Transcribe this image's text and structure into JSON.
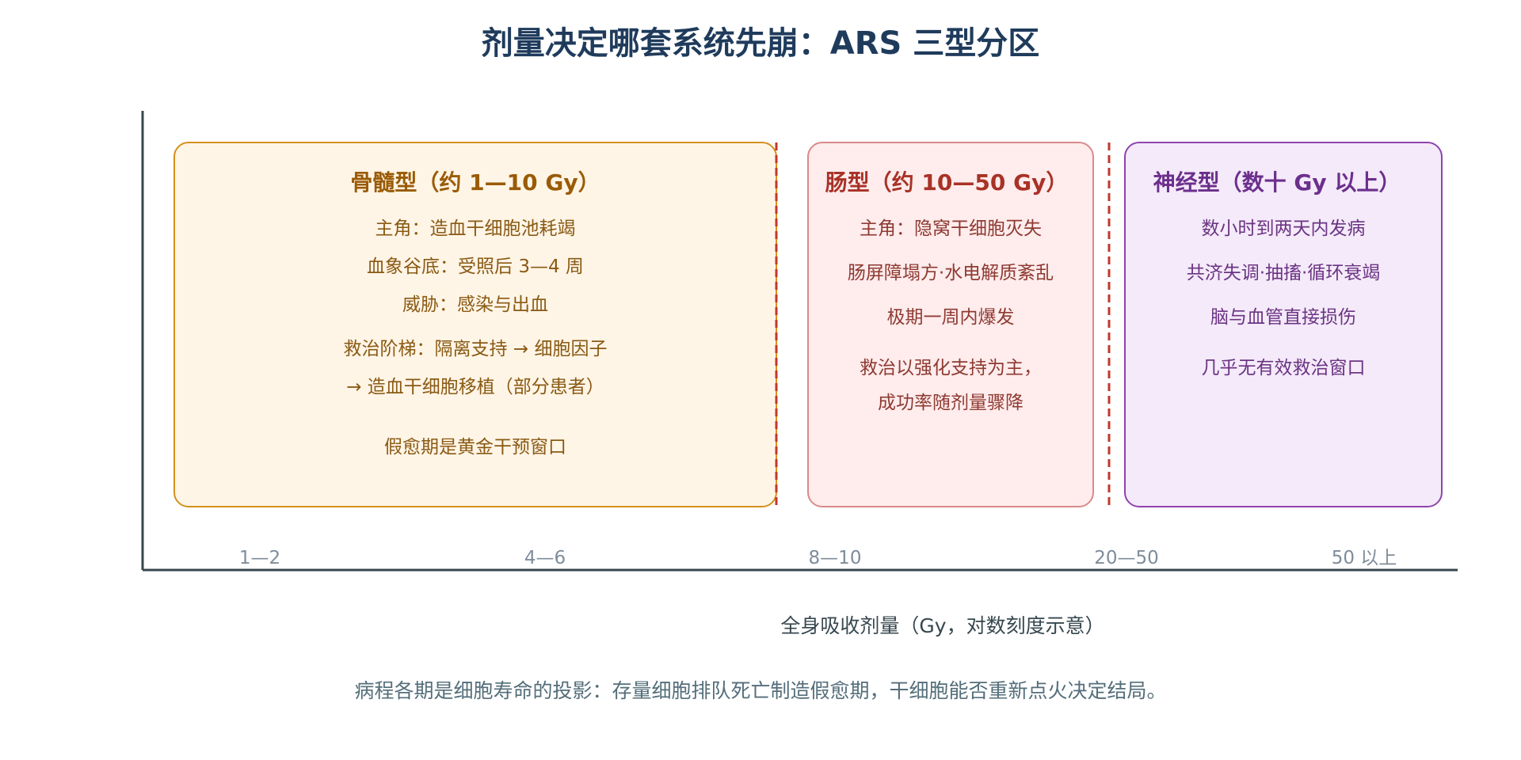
{
  "title": "剂量决定哪套系统先崩：ARS 三型分区",
  "x_axis": {
    "label": "全身吸收剂量（Gy，对数刻度示意）",
    "ticks": [
      "1—2",
      "4—6",
      "8—10",
      "20—50",
      "50 以上"
    ]
  },
  "zones": [
    {
      "id": "marrow",
      "title": "骨髓型（约 1—10 Gy）",
      "lines": [
        "主角：造血干细胞池耗竭",
        "血象谷底：受照后 3—4 周",
        "威胁：感染与出血",
        "救治阶梯：隔离支持 → 细胞因子",
        "→ 造血干细胞移植（部分患者）",
        "假愈期是黄金干预窗口"
      ]
    },
    {
      "id": "gut",
      "title": "肠型（约 10—50 Gy）",
      "lines": [
        "主角：隐窝干细胞灭失",
        "肠屏障塌方·水电解质紊乱",
        "极期一周内爆发",
        "救治以强化支持为主，",
        "成功率随剂量骤降"
      ]
    },
    {
      "id": "neuro",
      "title": "神经型（数十 Gy 以上）",
      "lines": [
        "数小时到两天内发病",
        "共济失调·抽搐·循环衰竭",
        "脑与血管直接损伤",
        "几乎无有效救治窗口"
      ]
    }
  ],
  "footer": "病程各期是细胞寿命的投影：存量细胞排队死亡制造假愈期，干细胞能否重新点火决定结局。",
  "colors": {
    "title": "#1f3b5c",
    "axis": "#37474f",
    "tick_text": "#7f8c9a",
    "axis_label": "#37474f",
    "footer": "#546e7a",
    "boundary": "#c0392b",
    "marrow_fill": "#fff5e6",
    "marrow_stroke": "#d4901c",
    "marrow_title": "#9a5b06",
    "marrow_text": "#8a5a14",
    "gut_fill": "#ffecec",
    "gut_stroke": "#d98a8a",
    "gut_title": "#a83227",
    "gut_text": "#8e3a32",
    "neuro_fill": "#f4eafa",
    "neuro_stroke": "#8e44ad",
    "neuro_title": "#6c2f8c",
    "neuro_text": "#6c3483"
  }
}
